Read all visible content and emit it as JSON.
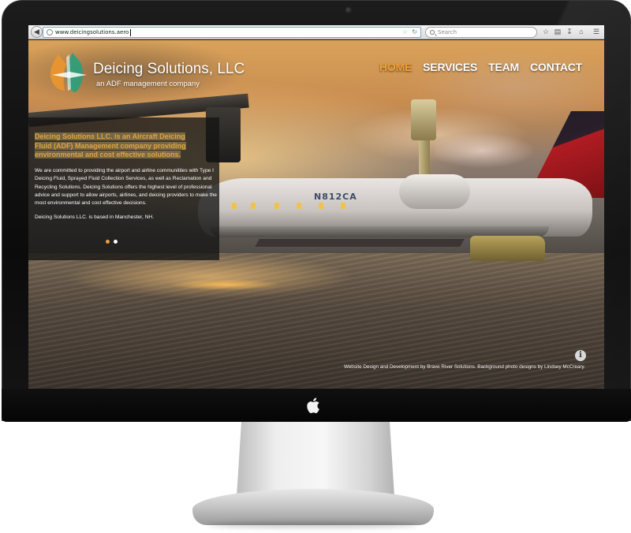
{
  "browser": {
    "url": "www.deicingsolutions.aero",
    "search_placeholder": "Search"
  },
  "site": {
    "title": "Deicing Solutions, LLC",
    "tagline": "an ADF management company"
  },
  "nav": {
    "items": [
      {
        "label": "HOME",
        "active": true
      },
      {
        "label": "SERVICES",
        "active": false
      },
      {
        "label": "TEAM",
        "active": false
      },
      {
        "label": "CONTACT",
        "active": false
      }
    ]
  },
  "panel": {
    "headline": "Deicing Solutions LLC. is an Aircraft Deicing Fluid (ADF) Management company providing environmental and cost effective solutions.",
    "body": "We are committed to providing the airport and airline communitites with Type I Deicing Fluid, Sprayed Fluid Collection Services, as well as Reclamation and Recycling Solutions.  Deicing Solutions offers the highest level of professional advice and support to allow airports, airlines, and deicing providers to make the most environmental and cost effective decisions.",
    "footnote": "Deicing Solutions LLC. is based in Manchester, NH.",
    "slides_total": 2,
    "slide_active": 1
  },
  "photo": {
    "tail_number": "N812CA"
  },
  "footer": {
    "credits": "Website Design and Development by Brave River Solutions. Background photo designs by Lindsey McCreary."
  },
  "colors": {
    "accent": "#e9a13b",
    "logo_orange": "#e8952f",
    "logo_green": "#2f9e7a"
  }
}
